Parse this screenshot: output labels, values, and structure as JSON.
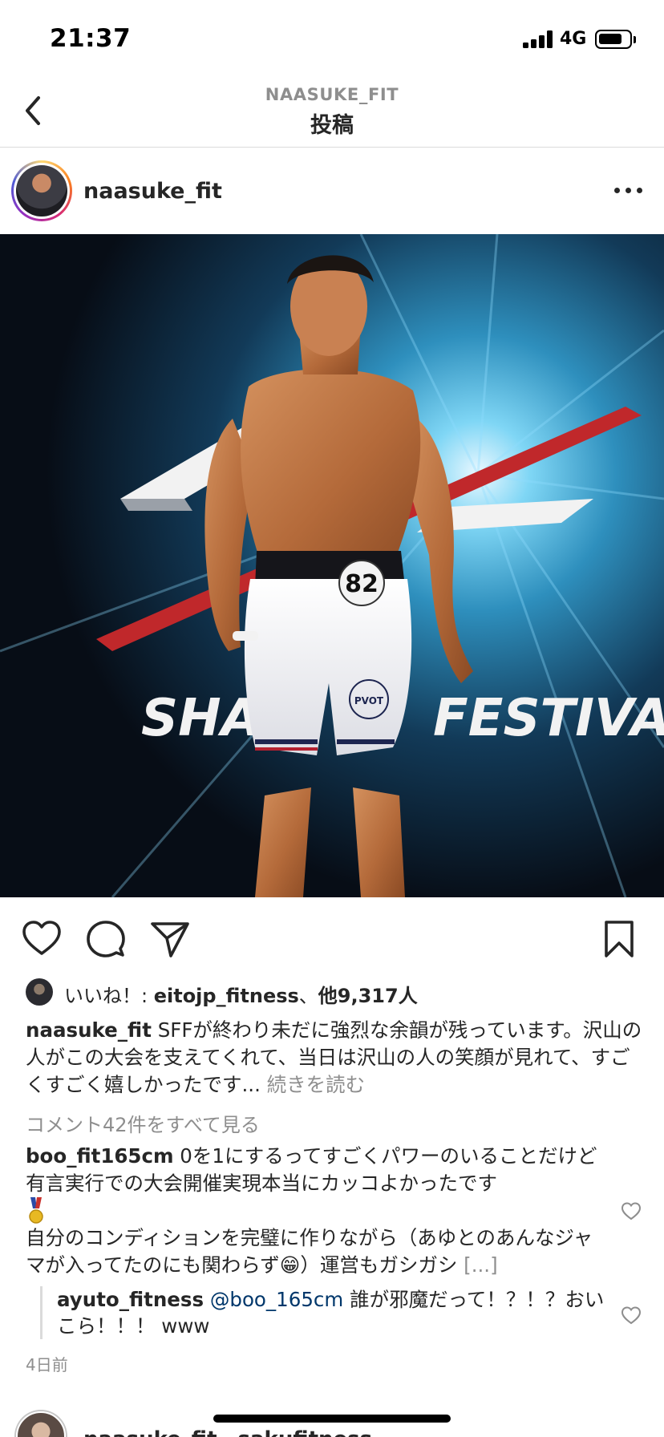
{
  "status_bar": {
    "time": "21:37",
    "network": "4G",
    "battery_level": 0.78
  },
  "header": {
    "account": "NAASUKE_FIT",
    "title": "投稿"
  },
  "post": {
    "username": "naasuke_fit",
    "photo": {
      "banner_text": "SHA",
      "banner_text_right": "FESTIVAL",
      "bib_number": "82",
      "shorts_logo_text": "PVOT"
    },
    "likes": {
      "prefix": "いいね！: ",
      "user": "eitojp_fitness",
      "separator": "、",
      "others": "他9,317人"
    },
    "caption": {
      "user": "naasuke_fit",
      "text": " SFFが終わり未だに強烈な余韻が残っています。沢山の人がこの大会を支えてくれて、当日は沢山の人の笑顔が見れて、すごくすごく嬉しかったです... ",
      "more": "続きを読む"
    },
    "view_comments": "コメント42件をすべて見る",
    "comments": [
      {
        "user": "boo_fit165cm",
        "text_a": " 0を1にするってすごくパワーのいることだけど有言実行での大会開催実現本当にカッコよかったです",
        "text_b": "自分のコンディションを完璧に作りながら（あゆとのあんなジャマが入ってたのにも関わらず",
        "emoji": "😁",
        "text_c": "）運営もガシガシ ",
        "more": "[...]"
      }
    ],
    "reply": {
      "user": "ayuto_fitness",
      "mention": "@boo_165cm",
      "text": " 誰が邪魔だって！？！？おいこら！！！ www"
    },
    "timestamp": "4日前"
  },
  "next_post": {
    "user": "naasuke_fit、sakufitness",
    "more": "..."
  },
  "colors": {
    "text": "#262626",
    "muted": "#8e8e8e",
    "link": "#00376b",
    "divider": "#dbdbdb"
  }
}
